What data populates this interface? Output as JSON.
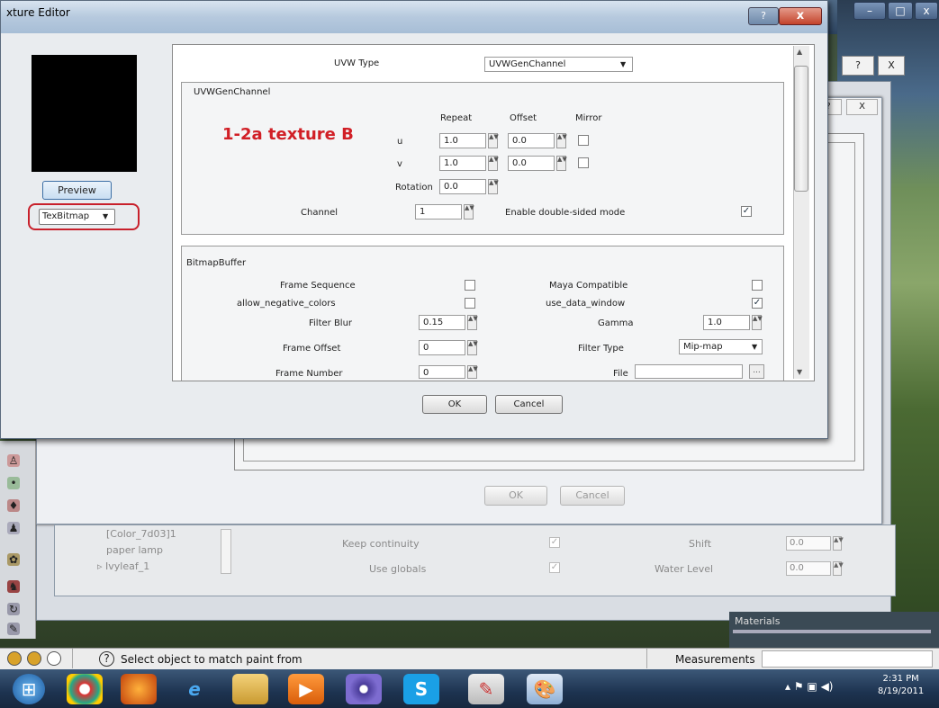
{
  "texture_editor": {
    "title": "xture Editor",
    "help_button": "?",
    "close_button": "x",
    "preview_button": "Preview",
    "type_select": "TexBitmap",
    "uvw_type_label": "UVW Type",
    "uvw_type_value": "UVWGenChannel",
    "annotation": "1-2a texture B",
    "uvwgen_group": {
      "title": "UVWGenChannel",
      "headers": {
        "repeat": "Repeat",
        "offset": "Offset",
        "mirror": "Mirror"
      },
      "u_label": "u",
      "v_label": "v",
      "u_repeat": "1.0",
      "u_offset": "0.0",
      "v_repeat": "1.0",
      "v_offset": "0.0",
      "rotation_label": "Rotation",
      "rotation_value": "0.0",
      "channel_label": "Channel",
      "channel_value": "1",
      "double_sided_label": "Enable double-sided mode",
      "double_sided_mark": "✓"
    },
    "bitmap_group": {
      "title": "BitmapBuffer",
      "frame_sequence": "Frame Sequence",
      "allow_negative": "allow_negative_colors",
      "filter_blur": "Filter Blur",
      "filter_blur_value": "0.15",
      "frame_offset": "Frame Offset",
      "frame_offset_value": "0",
      "frame_number": "Frame Number",
      "frame_number_value": "0",
      "maya_compatible": "Maya Compatible",
      "use_data_window": "use_data_window",
      "use_data_window_mark": "✓",
      "gamma": "Gamma",
      "gamma_value": "1.0",
      "filter_type": "Filter Type",
      "filter_type_value": "Mip-map",
      "file": "File",
      "browse": "..."
    },
    "ok": "OK",
    "cancel": "Cancel"
  },
  "back_window": {
    "ok": "OK",
    "cancel": "Cancel",
    "help": "?",
    "close": "X",
    "list_items": [
      "[Color_7d03]1",
      "paper lamp",
      "Ivyleaf_1"
    ],
    "keep_continuity": "Keep continuity",
    "use_globals": "Use globals",
    "shift": "Shift",
    "shift_value": "0.0",
    "water_level": "Water Level",
    "water_level_value": "0.0"
  },
  "materials_label": "Materials",
  "status": {
    "text": "Select object to match paint from",
    "measurements": "Measurements"
  },
  "taskbar": {
    "time": "2:31 PM",
    "date": "8/19/2011",
    "icons": [
      "windows-start-icon",
      "chrome-icon",
      "firefox-icon",
      "ie-icon",
      "explorer-icon",
      "media-icon",
      "app-icon",
      "skype-icon",
      "sketchup-icon",
      "paint-icon"
    ]
  }
}
